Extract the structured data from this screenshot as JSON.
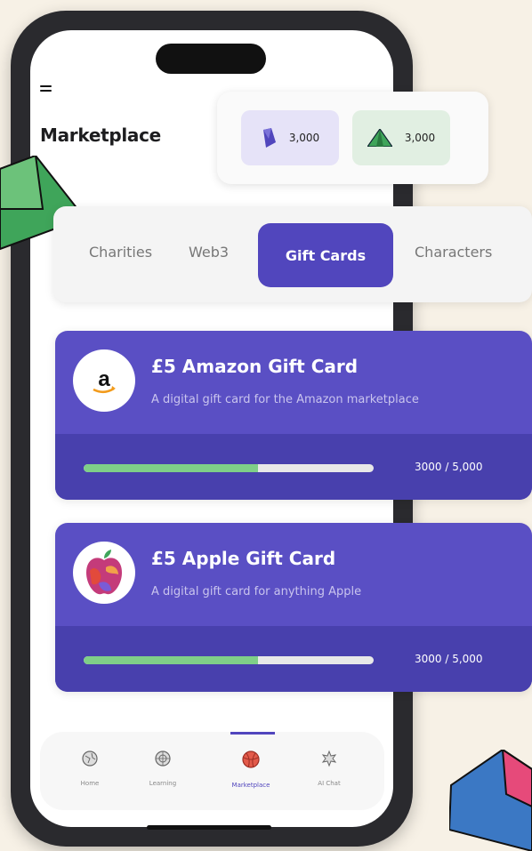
{
  "header": {
    "title": "Marketplace"
  },
  "balances": [
    {
      "icon": "purple-gem-icon",
      "value": "3,000",
      "color": "#5146bd"
    },
    {
      "icon": "green-pyramid-icon",
      "value": "3,000",
      "color": "#3fa55a"
    }
  ],
  "tabs": [
    {
      "label": "Charities",
      "active": false
    },
    {
      "label": "Web3",
      "active": false
    },
    {
      "label": "Gift Cards",
      "active": true
    },
    {
      "label": "Characters",
      "active": false
    }
  ],
  "cards": [
    {
      "title": "£5 Amazon Gift Card",
      "description": "A digital gift card for the Amazon marketplace",
      "progress_text": "3000 / 5,000",
      "progress": 0.6,
      "logo": "amazon-logo-icon"
    },
    {
      "title": "£5 Apple Gift Card",
      "description": "A digital gift card for anything Apple",
      "progress_text": "3000 / 5,000",
      "progress": 0.6,
      "logo": "apple-logo-icon"
    }
  ],
  "nav": [
    {
      "label": "Home",
      "icon": "home-globe-icon",
      "active": false
    },
    {
      "label": "Learning",
      "icon": "learning-icon",
      "active": false
    },
    {
      "label": "Marketplace",
      "icon": "marketplace-ball-icon",
      "active": true
    },
    {
      "label": "AI Chat",
      "icon": "ai-chat-icon",
      "active": false
    }
  ],
  "colors": {
    "accent": "#5146bd",
    "card": "#5a4fc4",
    "progress": "#7fcf88",
    "background": "#f7f1e6"
  }
}
